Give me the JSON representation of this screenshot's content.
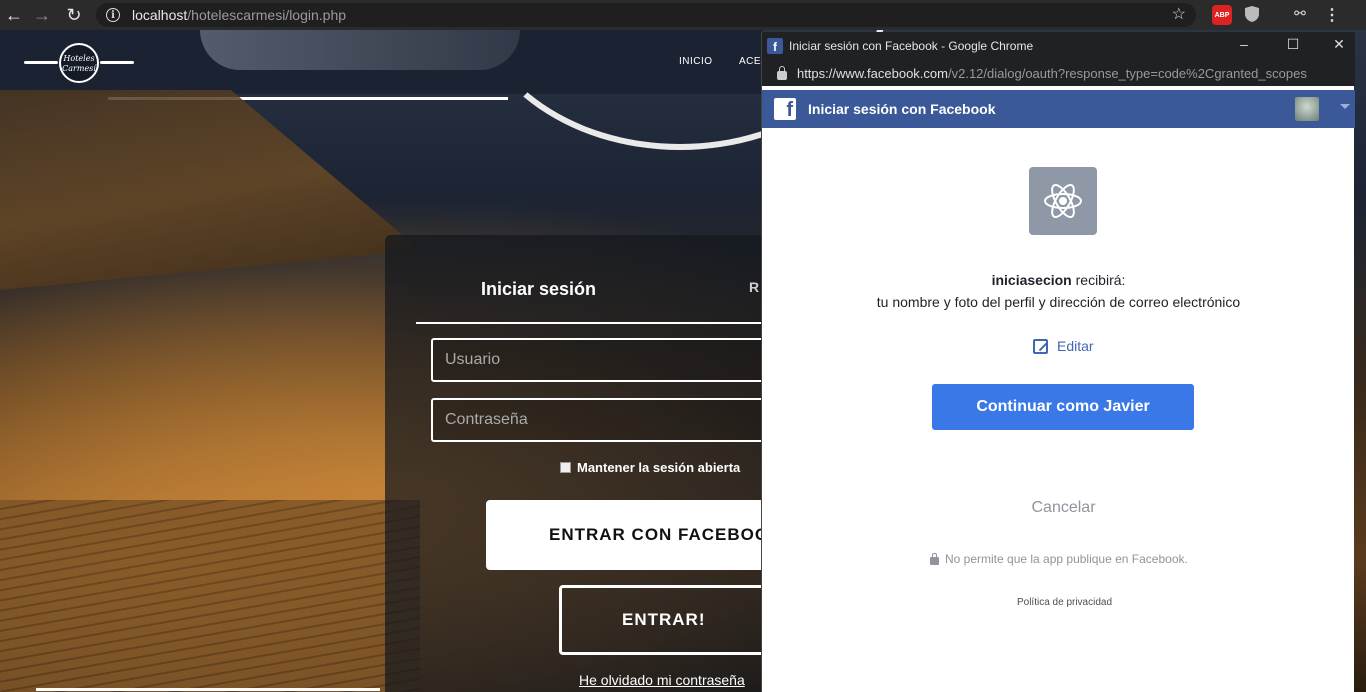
{
  "browser": {
    "url_host": "localhost",
    "url_path": "/hotelescarmesi/login.php",
    "abp_label": "ABP"
  },
  "site": {
    "logo_text": "Hoteles Carmesí",
    "nav": [
      "INICIO",
      "ACER"
    ],
    "login": {
      "title": "Iniciar sesión",
      "register_tab": "R",
      "username_placeholder": "Usuario",
      "password_placeholder": "Contraseña",
      "keep_session": "Mantener la sesión abierta",
      "facebook_button": "ENTRAR CON FACEBOOK",
      "enter_button": "ENTRAR!",
      "forgot_link": "He olvidado mi contraseña"
    }
  },
  "popup": {
    "window_title": "Iniciar sesión con Facebook - Google Chrome",
    "url_host": "https://www.facebook.com",
    "url_path": "/v2.12/dialog/oauth?response_type=code%2Cgranted_scopes",
    "bar_title": "Iniciar sesión con Facebook",
    "app_name": "iniciasecion",
    "receives": "recibirá:",
    "permissions": "tu nombre y foto del perfil y dirección de correo electrónico",
    "edit_label": "Editar",
    "continue_label": "Continuar como Javier",
    "cancel_label": "Cancelar",
    "no_post_text": "No permite que la app publique en Facebook.",
    "privacy_label": "Política de privacidad"
  },
  "colors": {
    "facebook_blue": "#3b5998",
    "continue_blue": "#3b78e7"
  }
}
